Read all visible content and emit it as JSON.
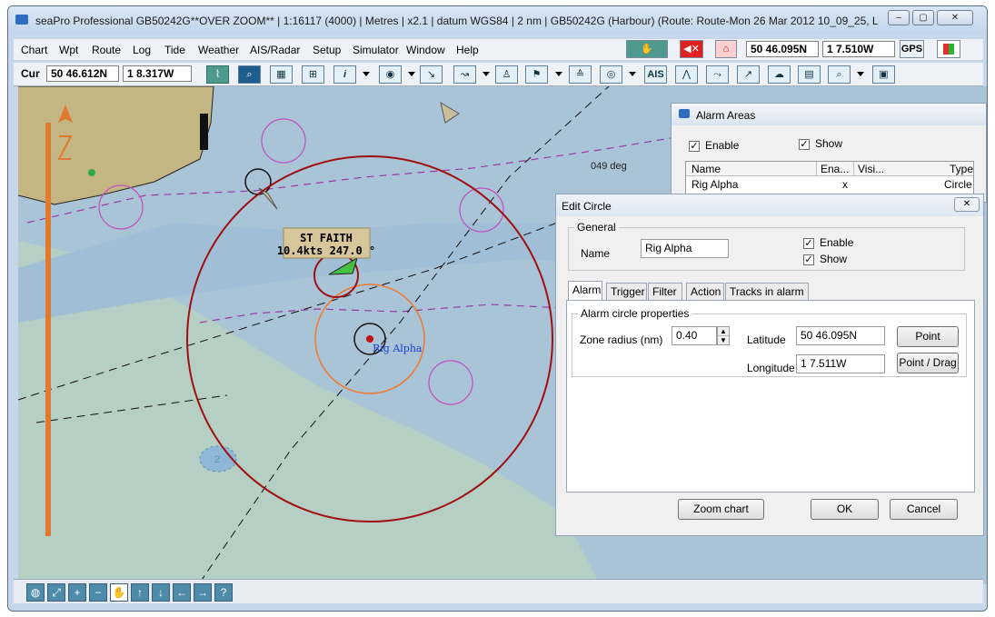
{
  "window": {
    "title": "seaPro Professional GB50242G**OVER ZOOM**  | 1:16117 (4000) | Metres | x2.1 | datum WGS84 | 2 nm | GB50242G (Harbour) (Route: Route-Mon 26 Mar 2012 10_09_25, L",
    "minimize": "–",
    "maximize": "▢",
    "close": "✕"
  },
  "menu": {
    "items": [
      "Chart",
      "Wpt",
      "Route",
      "Log",
      "Tide",
      "Weather",
      "AIS/Radar",
      "Setup",
      "Simulator",
      "Window",
      "Help"
    ],
    "lat": "50 46.095N",
    "lon": "1 7.510W",
    "gps": "GPS"
  },
  "toolbar": {
    "cur_label": "Cur",
    "cur_lat": "50 46.612N",
    "cur_lon": "1 8.317W",
    "ais": "AIS"
  },
  "chart": {
    "vessel_name": "ST FAITH",
    "vessel_info": "10.4kts 247.0 °",
    "rig_label": "Rig Alpha",
    "heading_label": "049 deg",
    "depth_label": "2"
  },
  "alarm_areas": {
    "title": "Alarm Areas",
    "enable_label": "Enable",
    "show_label": "Show",
    "columns": [
      "Name",
      "Ena...",
      "Visi...",
      "Type"
    ],
    "rows": [
      {
        "name": "Rig Alpha",
        "enabled": "x",
        "visible": "",
        "type": "Circle"
      }
    ]
  },
  "edit_circle": {
    "title": "Edit Circle",
    "general_label": "General",
    "name_label": "Name",
    "name_value": "Rig Alpha",
    "enable_label": "Enable",
    "show_label": "Show",
    "tabs": [
      "Alarm",
      "Trigger",
      "Filter",
      "Action",
      "Tracks in alarm"
    ],
    "props_label": "Alarm circle properties",
    "radius_label": "Zone radius (nm)",
    "radius_value": "0.40",
    "latitude_label": "Latitude",
    "latitude_value": "50 46.095N",
    "longitude_label": "Longitude",
    "longitude_value": "1  7.511W",
    "point_button": "Point",
    "point_drag_button": "Point / Drag",
    "zoom_button": "Zoom chart",
    "ok_button": "OK",
    "cancel_button": "Cancel"
  },
  "colors": {
    "water_deep": "#a9c3d7",
    "water_shallow": "#b6cfc4",
    "land": "#c4b682",
    "alarm_circle": "#a01010",
    "zone_circle": "#f07a30"
  }
}
